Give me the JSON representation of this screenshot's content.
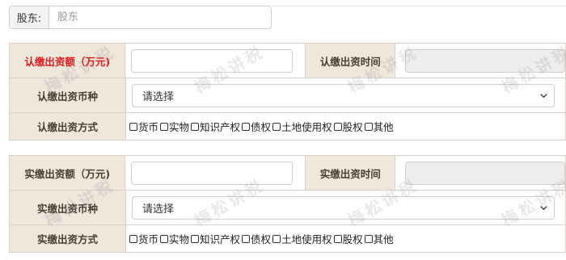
{
  "shareholder": {
    "label": "股东:",
    "placeholder": "股东"
  },
  "subscribed": {
    "amount_label": "认缴出资额（万元)",
    "amount_value": "",
    "time_label": "认缴出资时间",
    "time_value": "",
    "currency_label": "认缴出资币种",
    "currency_selected": "请选择",
    "method_label": "认缴出资方式",
    "methods": [
      "货币",
      "实物",
      "知识产权",
      "债权",
      "土地使用权",
      "股权",
      "其他"
    ]
  },
  "paid": {
    "amount_label": "实缴出资额（万元)",
    "amount_value": "",
    "time_label": "实缴出资时间",
    "time_value": "",
    "currency_label": "实缴出资币种",
    "currency_selected": "请选择",
    "method_label": "实缴出资方式",
    "methods": [
      "货币",
      "实物",
      "知识产权",
      "债权",
      "土地使用权",
      "股权",
      "其他"
    ]
  },
  "watermark": "梅松讲税",
  "colors": {
    "label_bg": "#efe6dc",
    "required_label": "#e5191b",
    "label_text": "#4a3d33",
    "disabled_bg": "#eeeeee"
  }
}
